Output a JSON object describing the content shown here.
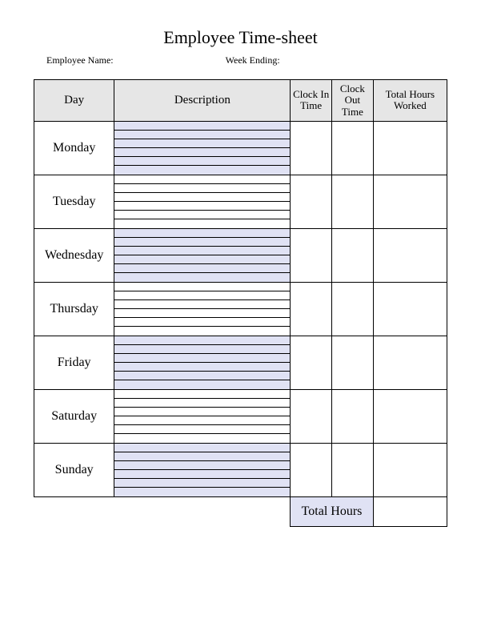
{
  "title": "Employee Time-sheet",
  "meta": {
    "employee_name_label": "Employee Name:",
    "week_ending_label": "Week Ending:"
  },
  "headers": {
    "day": "Day",
    "description": "Description",
    "clock_in": "Clock In Time",
    "clock_out": "Clock Out Time",
    "total_worked": "Total Hours Worked"
  },
  "days": [
    {
      "name": "Monday",
      "shaded": true
    },
    {
      "name": "Tuesday",
      "shaded": false
    },
    {
      "name": "Wednesday",
      "shaded": true
    },
    {
      "name": "Thursday",
      "shaded": false
    },
    {
      "name": "Friday",
      "shaded": true
    },
    {
      "name": "Saturday",
      "shaded": false
    },
    {
      "name": "Sunday",
      "shaded": true
    }
  ],
  "footer": {
    "total_hours_label": "Total Hours"
  },
  "lines_per_day": 6
}
